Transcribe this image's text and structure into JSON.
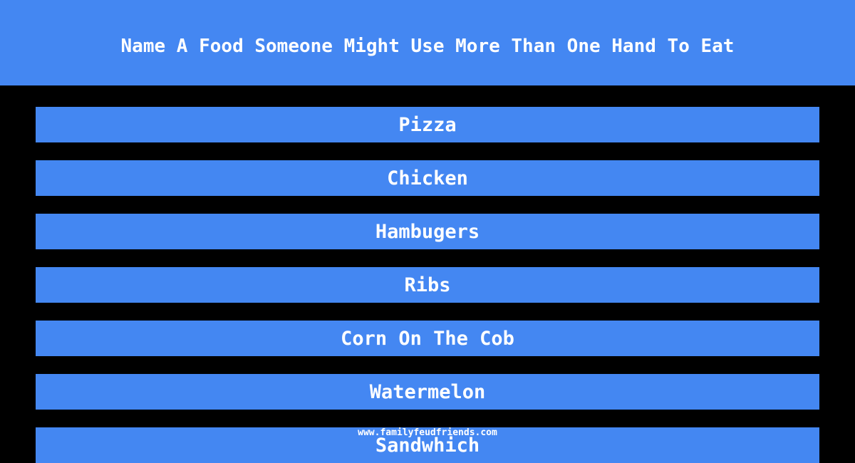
{
  "question": "Name A Food Someone Might Use More Than One Hand To Eat",
  "answers": [
    "Pizza",
    "Chicken",
    "Hambugers",
    "Ribs",
    "Corn On The Cob",
    "Watermelon",
    "Sandwhich"
  ],
  "footer": "www.familyfeudfriends.com",
  "colors": {
    "accent": "#4487f2",
    "background": "#000000",
    "text": "#ffffff"
  }
}
